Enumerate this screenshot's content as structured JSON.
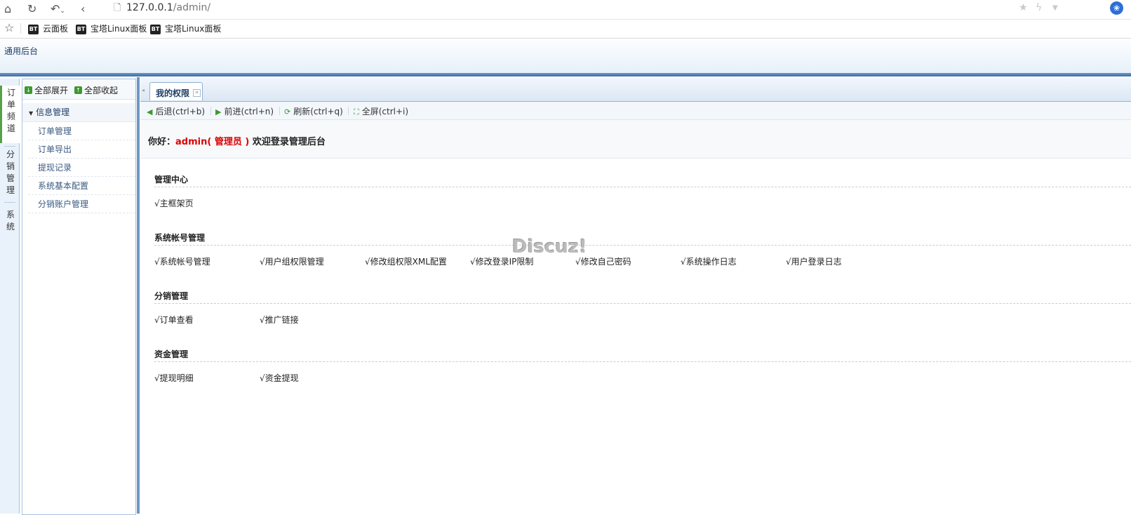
{
  "browser": {
    "url_host": "127.0.0.1",
    "url_path": "/admin/",
    "bookmarks": [
      {
        "badge": "BT",
        "label": "云面板"
      },
      {
        "badge": "BT",
        "label": "宝塔Linux面板"
      },
      {
        "badge": "BT",
        "label": "宝塔Linux面板"
      }
    ]
  },
  "app": {
    "title": "通用后台"
  },
  "channels": [
    {
      "label": "订单频道",
      "active": true
    },
    {
      "label": "分销管理",
      "active": false
    },
    {
      "label": "系统",
      "active": false
    }
  ],
  "menu": {
    "expand_all": "全部展开",
    "collapse_all": "全部收起",
    "group": "信息管理",
    "items": [
      "订单管理",
      "订单导出",
      "提现记录",
      "系统基本配置",
      "分销账户管理"
    ]
  },
  "tabs": [
    {
      "label": "我的权限"
    }
  ],
  "toolbar": {
    "back": "后退(ctrl+b)",
    "forward": "前进(ctrl+n)",
    "refresh": "刷新(ctrl+q)",
    "fullscreen": "全屏(ctrl+i)"
  },
  "welcome": {
    "greeting": "你好：",
    "user": "admin( 管理员 )",
    "message": "欢迎登录管理后台"
  },
  "sections": [
    {
      "title": "管理中心",
      "perms": [
        "√主框架页"
      ]
    },
    {
      "title": "系统帐号管理",
      "perms": [
        "√系统帐号管理",
        "√用户组权限管理",
        "√修改组权限XML配置",
        "√修改登录IP限制",
        "√修改自己密码",
        "√系统操作日志",
        "√用户登录日志"
      ]
    },
    {
      "title": "分销管理",
      "perms": [
        "√订单查看",
        "√推广链接"
      ]
    },
    {
      "title": "资金管理",
      "perms": [
        "√提现明细",
        "√资金提现"
      ]
    }
  ],
  "watermark": "Discuz!"
}
